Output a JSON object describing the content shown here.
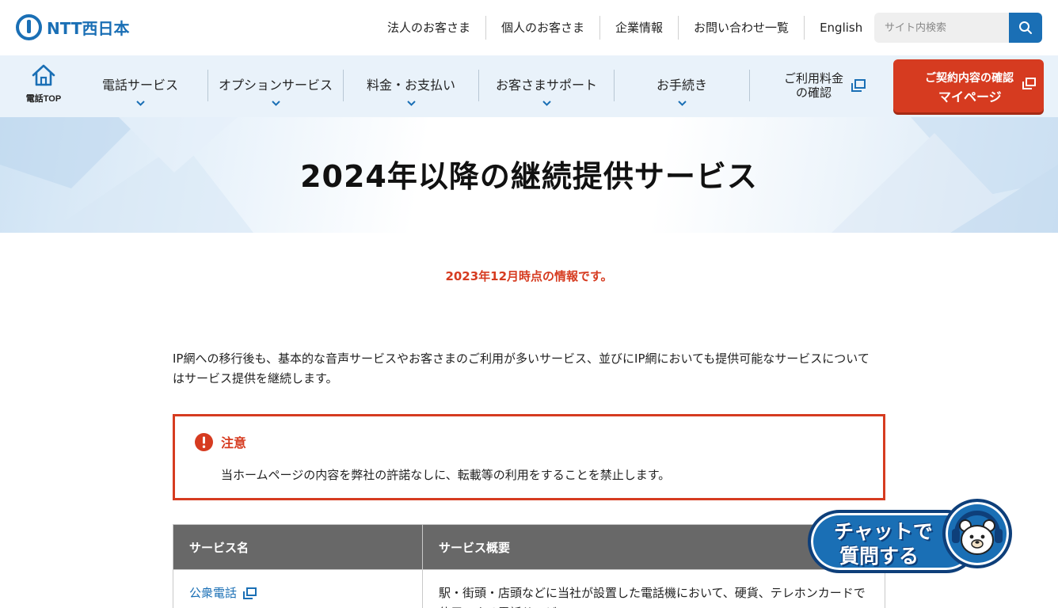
{
  "header": {
    "logo_text": "NTT西日本",
    "top_nav": [
      "法人のお客さま",
      "個人のお客さま",
      "企業情報",
      "お問い合わせ一覧",
      "English"
    ],
    "search_placeholder": "サイト内検索"
  },
  "main_nav": {
    "home_label": "電話TOP",
    "items": [
      "電話サービス",
      "オプションサービス",
      "料金・お支払い",
      "お客さまサポート",
      "お手続き"
    ],
    "billing_line1": "ご利用料金",
    "billing_line2": "の確認",
    "mypage_line1": "ご契約内容の確認",
    "mypage_line2": "マイページ"
  },
  "hero": {
    "title": "2024年以降の継続提供サービス"
  },
  "content": {
    "date_notice": "2023年12月時点の情報です。",
    "intro_line1": "IP網への移行後も、基本的な音声サービスやお客さまのご利用が多いサービス、並びにIP網においても提供可能なサービスについて",
    "intro_line2": "はサービス提供を継続します。",
    "caution_title": "注意",
    "caution_text": "当ホームページの内容を弊社の許諾なしに、転載等の利用をすることを禁止します。"
  },
  "table": {
    "headers": [
      "サービス名",
      "サービス概要"
    ],
    "rows": [
      {
        "name": "公衆電話",
        "summary": "駅・街頭・店頭などに当社が設置した電話機において、硬貨、テレホンカードで使用できる電話サービス"
      }
    ]
  },
  "chat": {
    "line1": "チャットで",
    "line2": "質問する"
  },
  "colors": {
    "brand_blue": "#1a6fb5",
    "accent_red": "#d63b20",
    "nav_bg": "#e9f2fa",
    "table_header": "#686868"
  }
}
